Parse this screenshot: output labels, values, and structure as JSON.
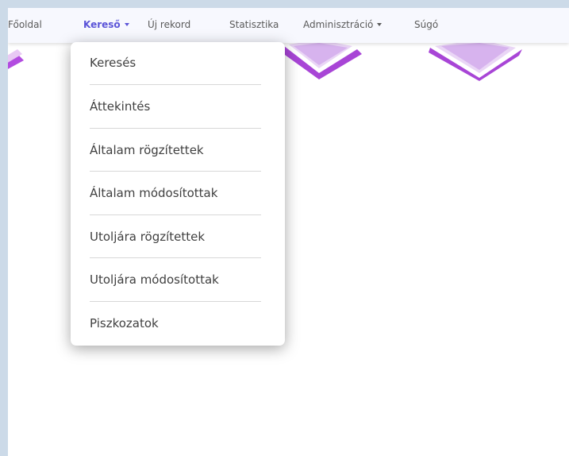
{
  "navbar": {
    "items": [
      {
        "label": "Főoldal",
        "active": false,
        "dropdown": false
      },
      {
        "label": "Kereső",
        "active": true,
        "dropdown": true
      },
      {
        "label": "Új rekord",
        "active": false,
        "dropdown": false
      },
      {
        "label": "Statisztika",
        "active": false,
        "dropdown": false
      },
      {
        "label": "Adminisztráció",
        "active": false,
        "dropdown": true
      },
      {
        "label": "Súgó",
        "active": false,
        "dropdown": false
      }
    ]
  },
  "dropdown": {
    "items": [
      {
        "label": "Keresés"
      },
      {
        "label": "Áttekintés"
      },
      {
        "label": "Általam rögzítettek"
      },
      {
        "label": "Általam módosítottak"
      },
      {
        "label": "Utoljára rögzítettek"
      },
      {
        "label": "Utoljára módosítottak"
      },
      {
        "label": "Piszkozatok"
      }
    ]
  },
  "colors": {
    "accent": "#5b54d8",
    "frame": "#ccdae8",
    "decor": "#a845d6"
  },
  "icons": {
    "caret": "caret-down-icon",
    "decor": "book-icon"
  }
}
